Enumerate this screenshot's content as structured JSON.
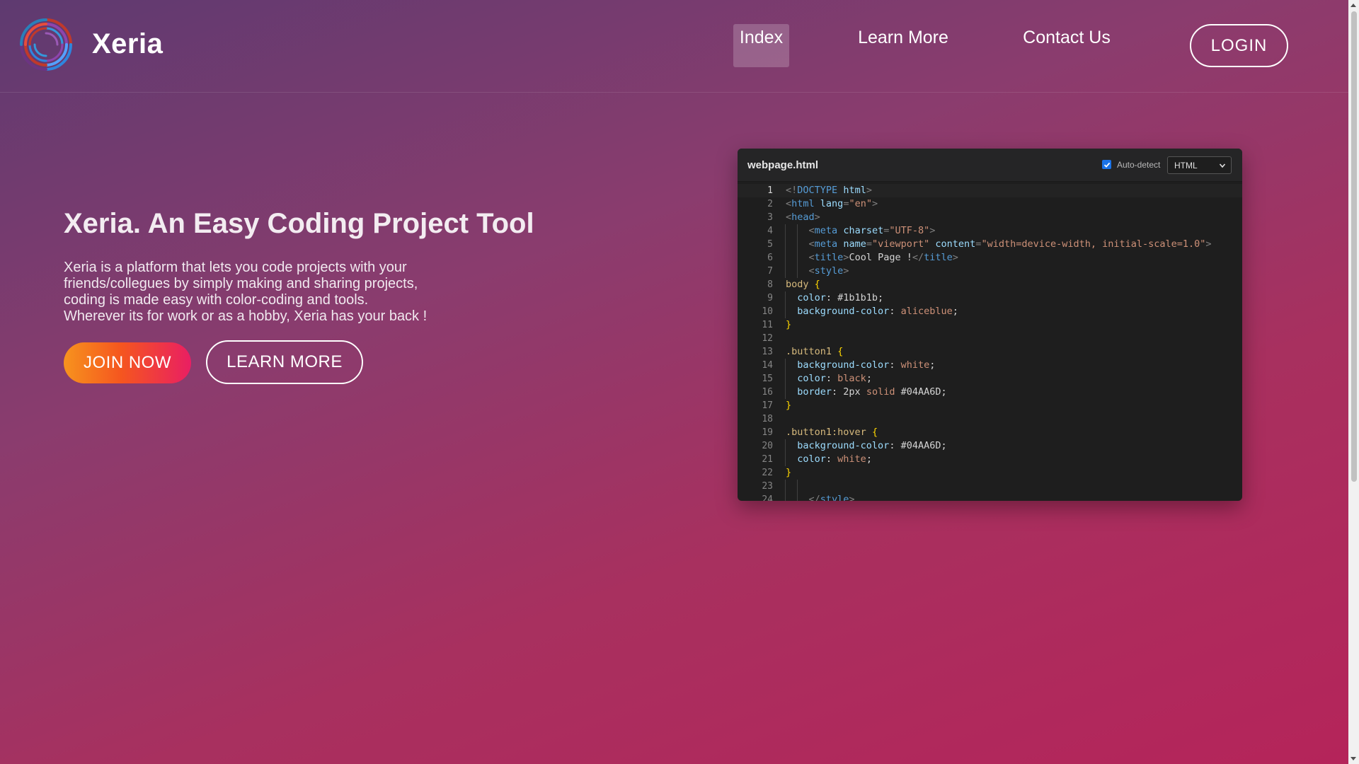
{
  "header": {
    "brand": "Xeria",
    "nav": [
      {
        "label": "Index",
        "active": true
      },
      {
        "label": "Learn More",
        "active": false
      },
      {
        "label": "Contact Us",
        "active": false
      }
    ],
    "login_label": "LOGIN"
  },
  "hero": {
    "title": "Xeria. An Easy Coding Project Tool",
    "description": [
      "Xeria is a platform that lets you code projects with your",
      "friends/collegues by simply making and sharing projects,",
      "coding is made easy with color-coding and tools.",
      "Wherever its for work or as a hobby, Xeria has your back !"
    ],
    "join_label": "JOIN NOW",
    "learn_label": "LEARN MORE"
  },
  "editor": {
    "file_name": "webpage.html",
    "auto_detect_label": "Auto-detect",
    "auto_detect_checked": true,
    "language": "HTML",
    "current_line": 1,
    "lines": [
      [
        [
          "t-punct",
          "<!"
        ],
        [
          "t-tag",
          "DOCTYPE"
        ],
        [
          "t-text",
          " "
        ],
        [
          "t-attr",
          "html"
        ],
        [
          "t-punct",
          ">"
        ]
      ],
      [
        [
          "t-punct",
          "<"
        ],
        [
          "t-tag",
          "html"
        ],
        [
          "t-text",
          " "
        ],
        [
          "t-attr",
          "lang"
        ],
        [
          "t-punct",
          "="
        ],
        [
          "t-str",
          "\"en\""
        ],
        [
          "t-punct",
          ">"
        ]
      ],
      [
        [
          "t-punct",
          "<"
        ],
        [
          "t-tag",
          "head"
        ],
        [
          "t-punct",
          ">"
        ]
      ],
      [
        [
          "t-text",
          "    "
        ],
        [
          "t-punct",
          "<"
        ],
        [
          "t-tag",
          "meta"
        ],
        [
          "t-text",
          " "
        ],
        [
          "t-attr",
          "charset"
        ],
        [
          "t-punct",
          "="
        ],
        [
          "t-str",
          "\"UTF-8\""
        ],
        [
          "t-punct",
          ">"
        ]
      ],
      [
        [
          "t-text",
          "    "
        ],
        [
          "t-punct",
          "<"
        ],
        [
          "t-tag",
          "meta"
        ],
        [
          "t-text",
          " "
        ],
        [
          "t-attr",
          "name"
        ],
        [
          "t-punct",
          "="
        ],
        [
          "t-str",
          "\"viewport\""
        ],
        [
          "t-text",
          " "
        ],
        [
          "t-attr",
          "content"
        ],
        [
          "t-punct",
          "="
        ],
        [
          "t-str",
          "\"width=device-width, initial-scale=1.0\""
        ],
        [
          "t-punct",
          ">"
        ]
      ],
      [
        [
          "t-text",
          "    "
        ],
        [
          "t-punct",
          "<"
        ],
        [
          "t-tag",
          "title"
        ],
        [
          "t-punct",
          ">"
        ],
        [
          "t-text",
          "Cool Page !"
        ],
        [
          "t-punct",
          "</"
        ],
        [
          "t-tag",
          "title"
        ],
        [
          "t-punct",
          ">"
        ]
      ],
      [
        [
          "t-text",
          "    "
        ],
        [
          "t-punct",
          "<"
        ],
        [
          "t-tag",
          "style"
        ],
        [
          "t-punct",
          ">"
        ]
      ],
      [
        [
          "t-sel",
          "body"
        ],
        [
          "t-text",
          " "
        ],
        [
          "t-brace",
          "{"
        ]
      ],
      [
        [
          "t-text",
          "  "
        ],
        [
          "t-prop",
          "color"
        ],
        [
          "t-text",
          ": #1b1b1b;"
        ]
      ],
      [
        [
          "t-text",
          "  "
        ],
        [
          "t-prop",
          "background-color"
        ],
        [
          "t-text",
          ": "
        ],
        [
          "t-str",
          "aliceblue"
        ],
        [
          "t-text",
          ";"
        ]
      ],
      [
        [
          "t-brace",
          "}"
        ]
      ],
      [],
      [
        [
          "t-sel",
          ".button1"
        ],
        [
          "t-text",
          " "
        ],
        [
          "t-brace",
          "{"
        ]
      ],
      [
        [
          "t-text",
          "  "
        ],
        [
          "t-prop",
          "background-color"
        ],
        [
          "t-text",
          ": "
        ],
        [
          "t-str",
          "white"
        ],
        [
          "t-text",
          ";"
        ]
      ],
      [
        [
          "t-text",
          "  "
        ],
        [
          "t-prop",
          "color"
        ],
        [
          "t-text",
          ": "
        ],
        [
          "t-str",
          "black"
        ],
        [
          "t-text",
          ";"
        ]
      ],
      [
        [
          "t-text",
          "  "
        ],
        [
          "t-prop",
          "border"
        ],
        [
          "t-text",
          ": 2px "
        ],
        [
          "t-str",
          "solid"
        ],
        [
          "t-text",
          " #04AA6D;"
        ]
      ],
      [
        [
          "t-brace",
          "}"
        ]
      ],
      [],
      [
        [
          "t-sel",
          ".button1:hover"
        ],
        [
          "t-text",
          " "
        ],
        [
          "t-brace",
          "{"
        ]
      ],
      [
        [
          "t-text",
          "  "
        ],
        [
          "t-prop",
          "background-color"
        ],
        [
          "t-text",
          ": #04AA6D;"
        ]
      ],
      [
        [
          "t-text",
          "  "
        ],
        [
          "t-prop",
          "color"
        ],
        [
          "t-text",
          ": "
        ],
        [
          "t-str",
          "white"
        ],
        [
          "t-text",
          ";"
        ]
      ],
      [
        [
          "t-brace",
          "}"
        ]
      ],
      [],
      [
        [
          "t-text",
          "    "
        ],
        [
          "t-punct",
          "</"
        ],
        [
          "t-tag",
          "style"
        ],
        [
          "t-punct",
          ">"
        ]
      ]
    ]
  }
}
